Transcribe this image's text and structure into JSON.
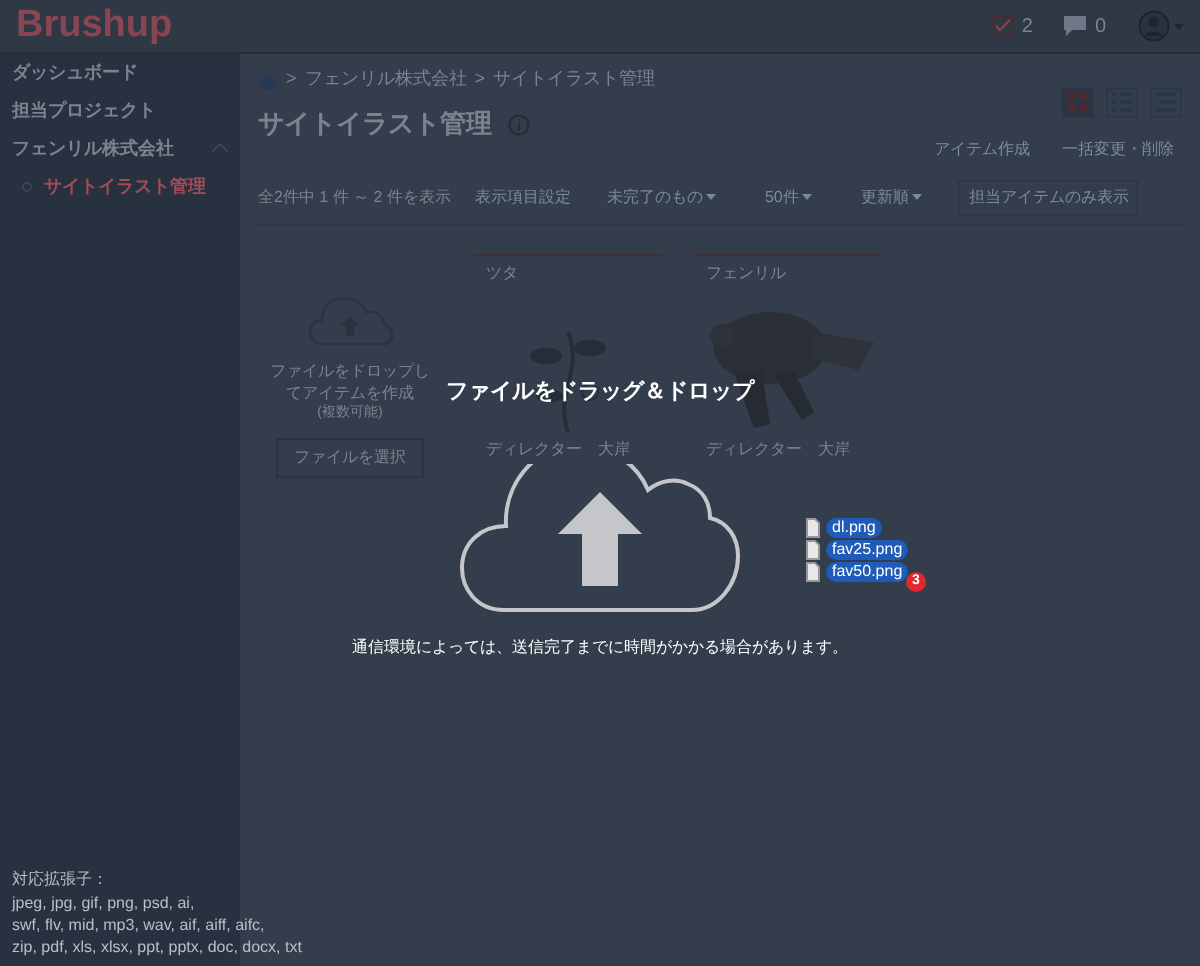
{
  "header": {
    "logo": "Brushup",
    "tasks_count": "2",
    "messages_count": "0"
  },
  "sidebar": {
    "items": [
      {
        "label": "ダッシュボード",
        "selected": false
      },
      {
        "label": "担当プロジェクト",
        "selected": false
      },
      {
        "label": "フェンリル株式会社",
        "selected": false,
        "expanded": true,
        "children": [
          {
            "label": "サイトイラスト管理",
            "selected": true
          }
        ]
      }
    ],
    "extensions_title": "対応拡張子：",
    "extensions": [
      "jpeg, jpg, gif, png, psd, ai,",
      "swf, flv, mid, mp3, wav, aif, aiff, aifc,",
      "zip, pdf, xls, xlsx, ppt, pptx, doc, docx, txt"
    ]
  },
  "breadcrumb": [
    {
      "separator": ">",
      "label": "フェンリル株式会社"
    },
    {
      "separator": ">",
      "label": "サイトイラスト管理"
    }
  ],
  "page_title": "サイトイラスト管理",
  "view_buttons": [
    {
      "kind": "grid",
      "selected": true
    },
    {
      "kind": "list",
      "selected": false
    },
    {
      "kind": "compact",
      "selected": false
    }
  ],
  "actions": [
    "アイテム作成",
    "一括変更・削除"
  ],
  "filters": {
    "count": "全2件中 1 件 ～ 2 件を表示",
    "settings_link": "表示項目設定",
    "dropdowns": [
      "未完了のもの",
      "50件",
      "更新順"
    ],
    "toggle": "担当アイテムのみ表示"
  },
  "drop_card": {
    "text": "ファイルをドロップしてアイテムを作成",
    "note": "(複数可能)",
    "button": "ファイルを選択"
  },
  "items": [
    {
      "title": "ツタ",
      "director": "ディレクター　大岸",
      "kind": "picture"
    },
    {
      "title": "フェンリル",
      "director": "ディレクター　大岸",
      "kind": "picture"
    }
  ],
  "overlay": {
    "title": "ファイルをドラッグ＆ドロップ",
    "note": "通信環境によっては、送信完了までに時間がかかる場合があります。",
    "files": [
      "dl.png",
      "fav25.png",
      "fav50.png"
    ],
    "file_count": "3"
  }
}
